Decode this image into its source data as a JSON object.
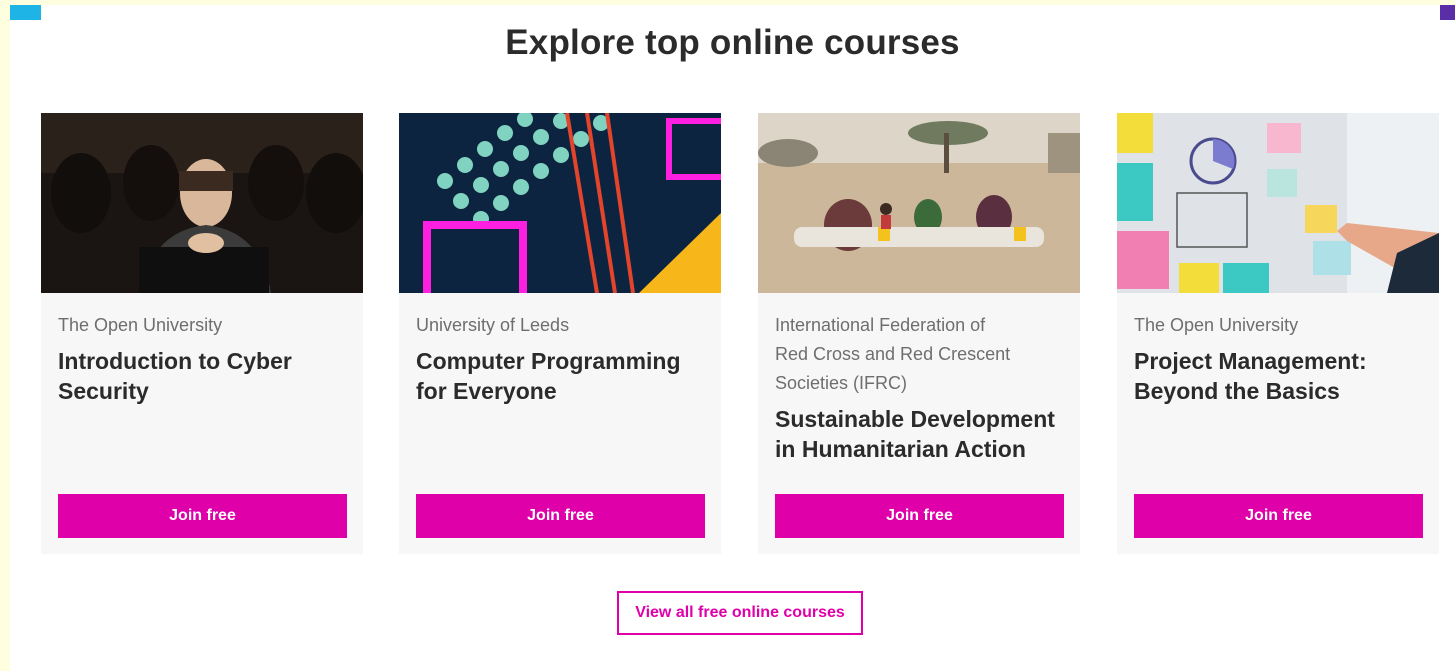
{
  "section": {
    "title": "Explore top online courses",
    "view_all_label": "View all free online courses"
  },
  "courses": [
    {
      "provider": "The Open University",
      "title_line1": "Introduction to Cyber",
      "title_line2": "Security",
      "join_label": "Join free"
    },
    {
      "provider": "University of Leeds",
      "title_line1": "Computer Programming",
      "title_line2": "for Everyone",
      "join_label": "Join free"
    },
    {
      "provider_line1": "International Federation of",
      "provider_line2": "Red Cross and Red Crescent",
      "provider_line3": "Societies (IFRC)",
      "title_line1": "Sustainable Development",
      "title_line2": "in Humanitarian Action",
      "join_label": "Join free"
    },
    {
      "provider": "The Open University",
      "title_line1": "Project Management:",
      "title_line2": "Beyond the Basics",
      "join_label": "Join free"
    }
  ],
  "colors": {
    "accent": "#df00a9",
    "card_bg": "#f7f7f7",
    "page_bg": "#ffffe0"
  }
}
